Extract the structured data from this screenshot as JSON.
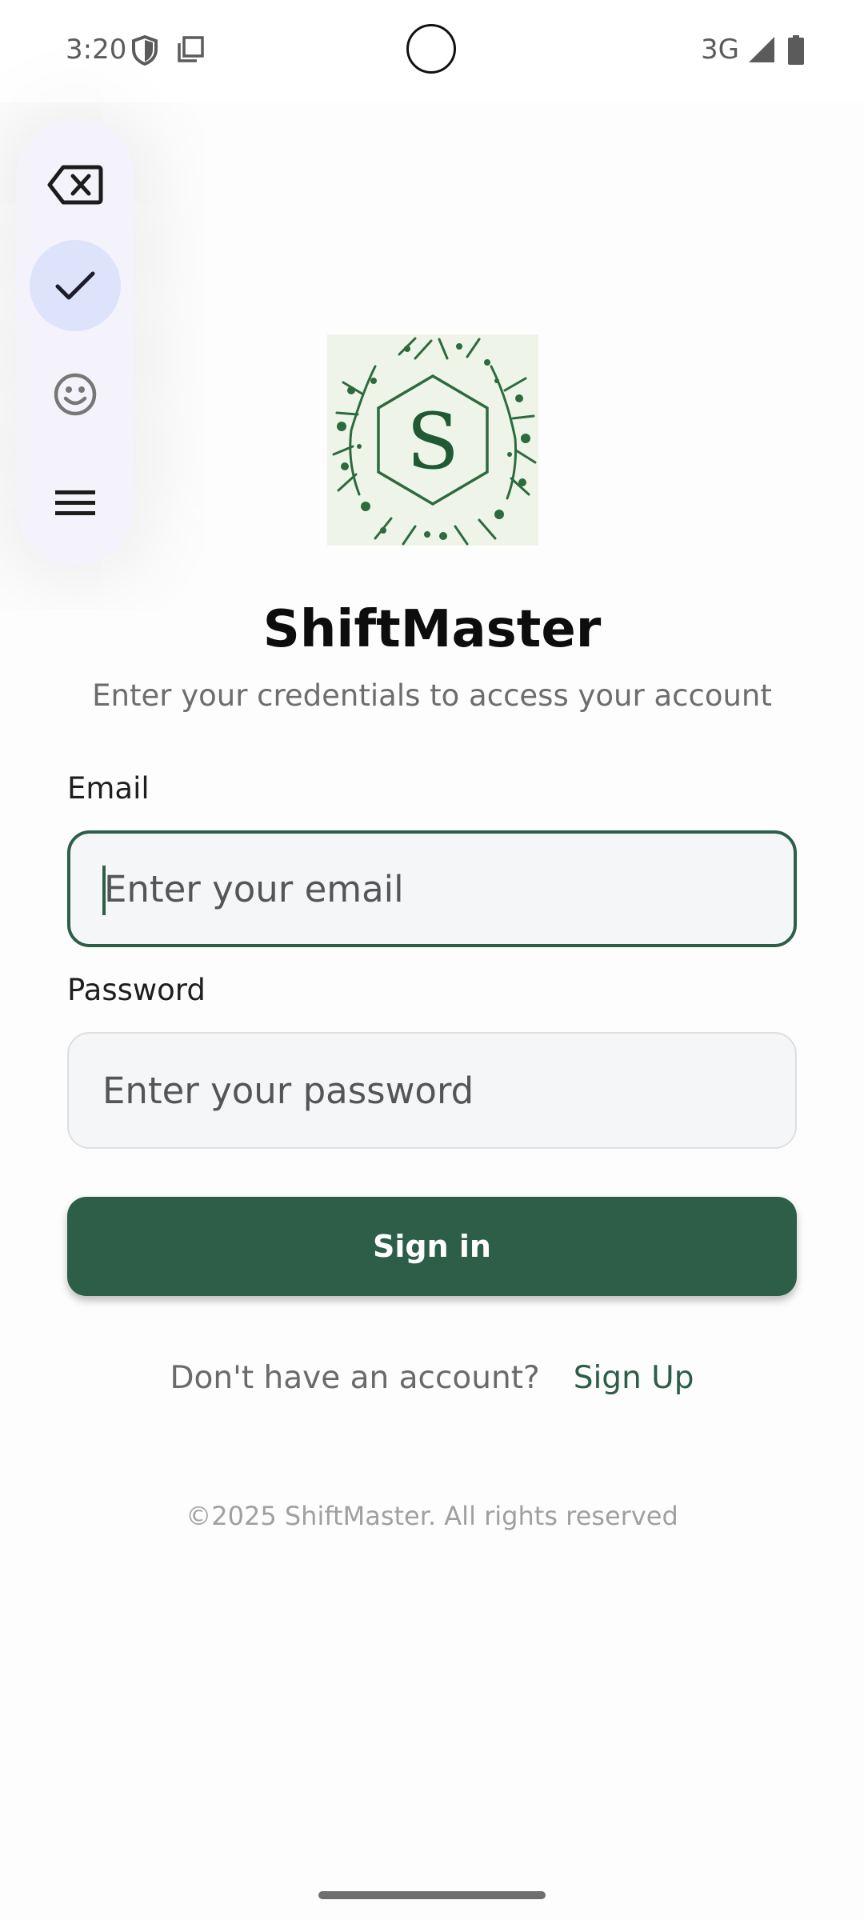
{
  "status_bar": {
    "time": "3:20",
    "network": "3G",
    "icons": [
      "shield-icon",
      "copy-icon",
      "signal-icon",
      "battery-icon"
    ]
  },
  "keyboard_toolbar": {
    "items": [
      "backspace-icon",
      "check-icon",
      "emoji-icon",
      "menu-icon"
    ],
    "active_item": "check-icon"
  },
  "logo": {
    "letter": "S"
  },
  "app": {
    "title": "ShiftMaster",
    "subtitle": "Enter your credentials to access your account"
  },
  "form": {
    "email_label": "Email",
    "email_placeholder": "Enter your email",
    "email_value": "",
    "password_label": "Password",
    "password_placeholder": "Enter your password",
    "password_value": "",
    "signin_label": "Sign in"
  },
  "signup": {
    "prompt": "Don't have an account?",
    "link": "Sign Up"
  },
  "footer": {
    "copyright": "©2025 ShiftMaster. All rights reserved"
  },
  "colors": {
    "primary": "#2d5e48",
    "background": "#fdfdfe",
    "input_bg": "#f5f6f8",
    "toolbar_bg": "#f4f3fb",
    "toolbar_active": "#dde3fb"
  }
}
